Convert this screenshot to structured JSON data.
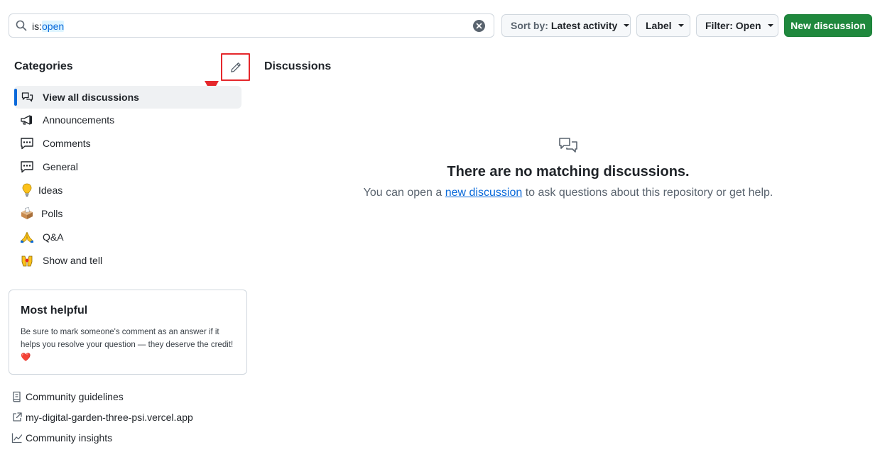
{
  "search": {
    "query_key": "is:",
    "query_value": "open"
  },
  "toolbar": {
    "sort_prefix": "Sort by:",
    "sort_value": "Latest activity",
    "label": "Label",
    "filter": "Filter: Open",
    "new_discussion": "New discussion"
  },
  "sidebar": {
    "title": "Categories",
    "items": [
      {
        "label": "View all discussions",
        "icon": "comment-discussion-icon",
        "active": true
      },
      {
        "label": "Announcements",
        "icon": "megaphone-icon"
      },
      {
        "label": "Comments",
        "icon": "speech-balloon-icon"
      },
      {
        "label": "General",
        "icon": "speech-balloon-icon"
      },
      {
        "label": "Ideas",
        "icon": "lightbulb-icon"
      },
      {
        "label": "Polls",
        "icon": "ballot-box-icon"
      },
      {
        "label": "Q&A",
        "icon": "folded-hands-icon"
      },
      {
        "label": "Show and tell",
        "icon": "raised-hands-icon"
      }
    ],
    "helpful": {
      "title": "Most helpful",
      "body": "Be sure to mark someone's comment as an answer if it helps you resolve your question — they deserve the credit!",
      "emoji": "❤️"
    },
    "links": [
      {
        "label": "Community guidelines",
        "icon": "book-icon"
      },
      {
        "label": "my-digital-garden-three-psi.vercel.app",
        "icon": "link-external-icon"
      },
      {
        "label": "Community insights",
        "icon": "graph-icon"
      }
    ]
  },
  "main": {
    "title": "Discussions",
    "empty_title": "There are no matching discussions.",
    "empty_sub_prefix": "You can open a",
    "empty_sub_link": "new discussion",
    "empty_sub_suffix": "to ask questions about this repository or get help."
  },
  "colors": {
    "accent": "#0969da",
    "primary_button": "#1f883d",
    "annotation": "#e5282c"
  }
}
